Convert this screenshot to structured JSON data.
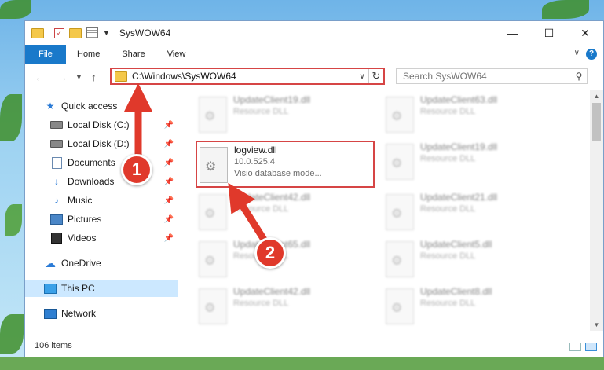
{
  "window": {
    "title": "SysWOW64",
    "controls": {
      "minimize": "—",
      "maximize": "☐",
      "close": "✕"
    }
  },
  "ribbon": {
    "tabs": [
      "File",
      "Home",
      "Share",
      "View"
    ],
    "help": "?"
  },
  "address_bar": {
    "path": "C:\\Windows\\SysWOW64",
    "dropdown": "∨",
    "refresh": "↻"
  },
  "search": {
    "placeholder": "Search SysWOW64"
  },
  "nav_pane": {
    "items": [
      {
        "label": "Quick access",
        "icon": "star-icon"
      },
      {
        "label": "Local Disk (C:)",
        "icon": "drive-icon",
        "pinned": true
      },
      {
        "label": "Local Disk (D:)",
        "icon": "drive-icon",
        "pinned": true
      },
      {
        "label": "Documents",
        "icon": "documents-icon",
        "pinned": true
      },
      {
        "label": "Downloads",
        "icon": "download-icon",
        "pinned": true
      },
      {
        "label": "Music",
        "icon": "music-icon",
        "pinned": true
      },
      {
        "label": "Pictures",
        "icon": "pictures-icon",
        "pinned": true
      },
      {
        "label": "Videos",
        "icon": "videos-icon",
        "pinned": true
      },
      {
        "label": "OneDrive",
        "icon": "cloud-icon"
      },
      {
        "label": "This PC",
        "icon": "computer-icon",
        "selected": true
      },
      {
        "label": "Network",
        "icon": "network-icon"
      }
    ]
  },
  "files": {
    "left": [
      {
        "name": "UpdateClient19.dll",
        "sub": "Resource DLL"
      },
      {
        "name": "logview.dll",
        "version": "10.0.525.4",
        "desc": "Visio database mode..."
      },
      {
        "name": "UpdateClient42.dll",
        "sub": "Resource DLL"
      },
      {
        "name": "UpdateClient65.dll",
        "sub": "Resource DLL"
      },
      {
        "name": "UpdateClient42.dll",
        "sub": "Resource DLL"
      }
    ],
    "right": [
      {
        "name": "UpdateClient63.dll",
        "sub": "Resource DLL"
      },
      {
        "name": "UpdateClient19.dll",
        "sub": "Resource DLL"
      },
      {
        "name": "UpdateClient21.dll",
        "sub": "Resource DLL"
      },
      {
        "name": "UpdateClient5.dll",
        "sub": "Resource DLL"
      },
      {
        "name": "UpdateClient8.dll",
        "sub": "Resource DLL"
      }
    ]
  },
  "status": {
    "items": "106 items"
  },
  "annotations": {
    "step1": "1",
    "step2": "2",
    "color": "#e0392b"
  }
}
